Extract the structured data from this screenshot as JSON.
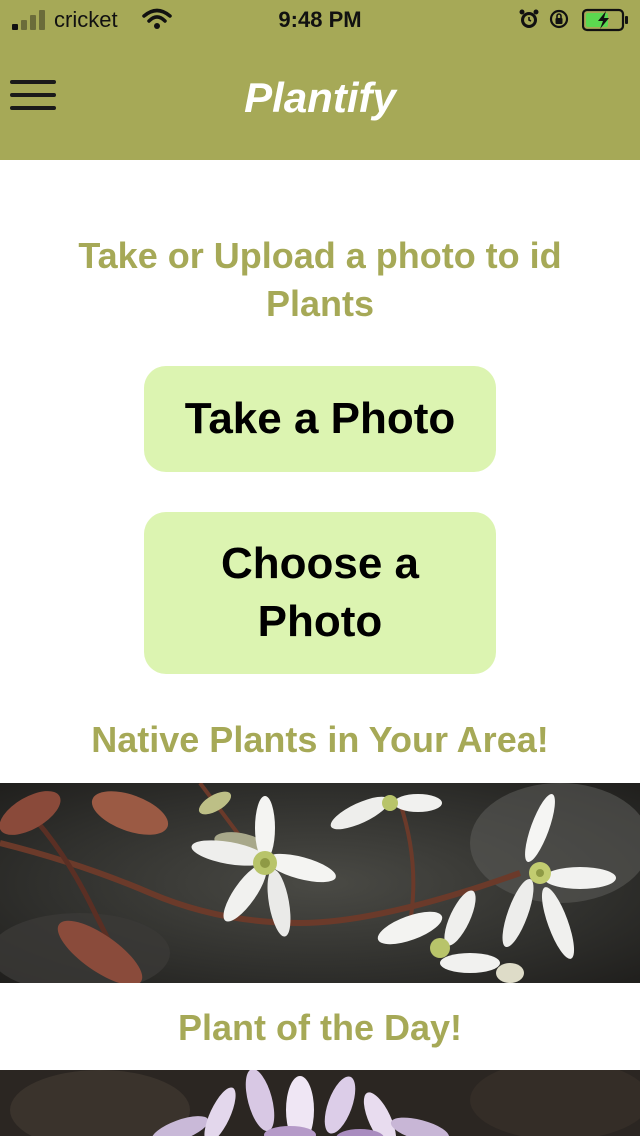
{
  "status_bar": {
    "carrier": "cricket",
    "time": "9:48 PM",
    "icons": [
      "signal-icon",
      "wifi-icon",
      "alarm-icon",
      "rotation-lock-icon",
      "battery-charging-icon"
    ]
  },
  "header": {
    "title": "Plantify",
    "menu_icon": "hamburger-menu-icon"
  },
  "main": {
    "intro_heading": "Take or Upload a photo to id Plants",
    "take_photo_label": "Take a Photo",
    "choose_photo_label": "Choose a Photo",
    "native_heading": "Native Plants in Your Area!",
    "plant_of_day_heading": "Plant of the Day!"
  },
  "colors": {
    "header_background": "#a6a957",
    "accent_text": "#a6a957",
    "button_background": "#dcf4b1",
    "title_text": "#ffffff"
  }
}
